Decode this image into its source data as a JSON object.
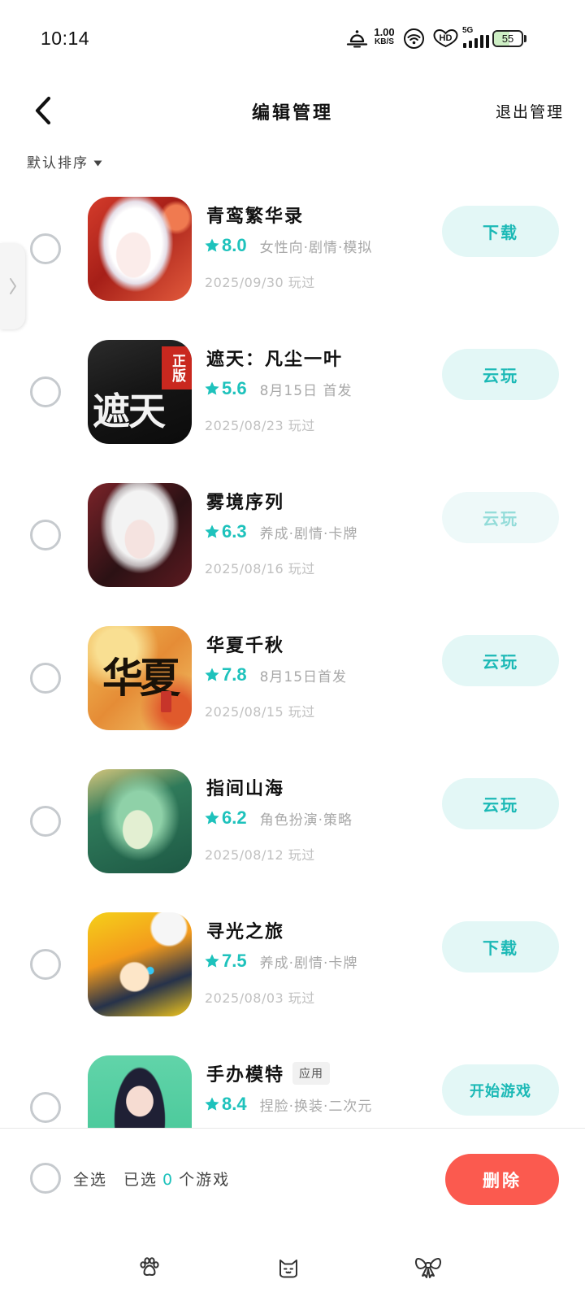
{
  "status_bar": {
    "time": "10:14",
    "net_speed": "1.00",
    "net_speed_unit": "KB/S",
    "hd_label": "HD",
    "network_type": "5G",
    "battery_level": "55"
  },
  "header": {
    "title": "编辑管理",
    "exit_label": "退出管理"
  },
  "sort": {
    "label": "默认排序"
  },
  "games": [
    {
      "title": "青鸾繁华录",
      "rating": "8.0",
      "tags": "女性向·剧情·模拟",
      "played": "2025/09/30 玩过",
      "action": "下载",
      "action_enabled": true
    },
    {
      "title": "遮天：凡尘一叶",
      "icon_logo": "遮天",
      "icon_badge": "正版",
      "rating": "5.6",
      "tags": "8月15日 首发",
      "played": "2025/08/23 玩过",
      "action": "云玩",
      "action_enabled": true
    },
    {
      "title": "雾境序列",
      "rating": "6.3",
      "tags": "养成·剧情·卡牌",
      "played": "2025/08/16 玩过",
      "action": "云玩",
      "action_enabled": false
    },
    {
      "title": "华夏千秋",
      "icon_logo": "华夏",
      "rating": "7.8",
      "tags": "8月15日首发",
      "played": "2025/08/15 玩过",
      "action": "云玩",
      "action_enabled": true
    },
    {
      "title": "指间山海",
      "rating": "6.2",
      "tags": "角色扮演·策略",
      "played": "2025/08/12 玩过",
      "action": "云玩",
      "action_enabled": true
    },
    {
      "title": "寻光之旅",
      "rating": "7.5",
      "tags": "养成·剧情·卡牌",
      "played": "2025/08/03 玩过",
      "action": "下载",
      "action_enabled": true
    },
    {
      "title": "手办模特",
      "badge": "应用",
      "rating": "8.4",
      "tags": "捏脸·换装·二次元",
      "action": "开始游戏",
      "action_enabled": true
    }
  ],
  "footer": {
    "select_all_label": "全选",
    "selected_prefix": "已选",
    "selected_count": "0",
    "selected_suffix": "个游戏",
    "delete_label": "删除"
  },
  "icons": {
    "back": "chevron-left-icon",
    "sort": "caret-down-icon",
    "side_handle": "chevron-right-icon",
    "rating": "star-icon"
  },
  "bottom_nav": [
    {
      "icon": "paw-icon"
    },
    {
      "icon": "cat-icon"
    },
    {
      "icon": "bow-icon"
    }
  ],
  "colors": {
    "accent": "#1ec2bc",
    "action_bg": "#e3f7f6",
    "action_text": "#1cb9b6",
    "delete_bg": "#fb5a4f",
    "radio_border": "#c6cace"
  }
}
